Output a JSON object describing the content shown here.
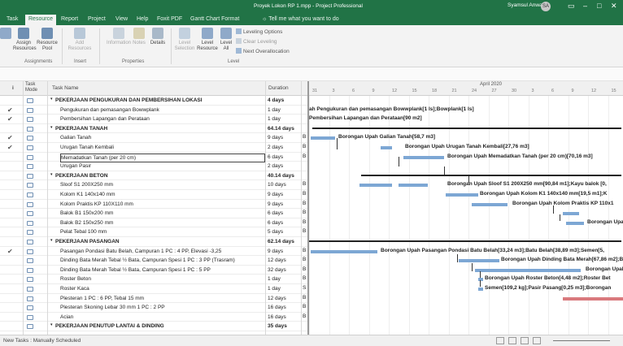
{
  "window": {
    "title": "Proyek Lokon RP 1.mpp  -  Project Professional",
    "user": "Syamsul Anwar",
    "user_initials": "SA"
  },
  "ribbon_tabs": [
    "Task",
    "Resource",
    "Report",
    "Project",
    "View",
    "Help",
    "Foxit PDF",
    "Gantt Chart Format"
  ],
  "tell_me": "Tell me what you want to do",
  "ribbon": {
    "buttons": [
      {
        "label": "Team\nPlanner",
        "icon": "team-planner-icon"
      },
      {
        "label": "Assign\nResources",
        "icon": "assign-resources-icon"
      },
      {
        "label": "Resource\nPool",
        "icon": "resource-pool-icon"
      },
      {
        "label": "Add\nResources",
        "icon": "add-resources-icon"
      },
      {
        "label": "Information",
        "icon": "information-icon"
      },
      {
        "label": "Notes",
        "icon": "notes-icon"
      },
      {
        "label": "Details",
        "icon": "details-icon"
      },
      {
        "label": "Level\nSelection",
        "icon": "level-selection-icon"
      },
      {
        "label": "Level\nResource",
        "icon": "level-resource-icon"
      },
      {
        "label": "Level\nAll",
        "icon": "level-all-icon"
      }
    ],
    "groups": [
      "Assignments",
      "Insert",
      "Properties",
      "Level"
    ],
    "level_options": [
      "Leveling Options",
      "Clear Leveling",
      "Next Overallocation"
    ]
  },
  "columns": {
    "info": "i",
    "mode": "Task Mode",
    "name": "Task Name",
    "duration": "Duration"
  },
  "gantt": {
    "month": "April 2020",
    "days": [
      "31",
      "3",
      "6",
      "9",
      "12",
      "15",
      "18",
      "21",
      "24",
      "27",
      "30",
      "3",
      "6",
      "9",
      "12",
      "15"
    ]
  },
  "tasks": [
    {
      "num": "",
      "check": "",
      "name": "PEKERJAAN PENGUKURAN DAN PEMBERSIHAN LOKASI",
      "duration": "4 days",
      "summary": true,
      "indent": 0,
      "start": ""
    },
    {
      "num": "",
      "check": "✔",
      "name": "Pengukuran dan pemasangan Bowwplank",
      "duration": "1 day",
      "summary": false,
      "indent": 1,
      "start": ""
    },
    {
      "num": "",
      "check": "✔",
      "name": "Pembersihan Lapangan dan Perataan",
      "duration": "1 day",
      "summary": false,
      "indent": 1,
      "start": ""
    },
    {
      "num": "",
      "check": "",
      "name": "PEKERJAAN TANAH",
      "duration": "64.14 days",
      "summary": true,
      "indent": 0,
      "start": ""
    },
    {
      "num": "",
      "check": "✔",
      "name": "Galian Tanah",
      "duration": "9 days",
      "summary": false,
      "indent": 1,
      "start": "B"
    },
    {
      "num": "",
      "check": "✔",
      "name": "Urugan Tanah Kembali",
      "duration": "2 days",
      "summary": false,
      "indent": 1,
      "start": "B"
    },
    {
      "num": "",
      "check": "",
      "name": "Memadatkan Tanah (per 20 cm)",
      "duration": "6 days",
      "summary": false,
      "indent": 1,
      "start": "B",
      "selected": true
    },
    {
      "num": "",
      "check": "",
      "name": "Urugan Pasir",
      "duration": "2 days",
      "summary": false,
      "indent": 1,
      "start": ""
    },
    {
      "num": "",
      "check": "",
      "name": "PEKERJAAN BETON",
      "duration": "40.14 days",
      "summary": true,
      "indent": 0,
      "start": ""
    },
    {
      "num": "",
      "check": "",
      "name": "Sloof S1 200X250 mm",
      "duration": "10 days",
      "summary": false,
      "indent": 1,
      "start": "B"
    },
    {
      "num": "",
      "check": "",
      "name": "Kolom K1 140x140 mm",
      "duration": "9 days",
      "summary": false,
      "indent": 1,
      "start": "B"
    },
    {
      "num": "",
      "check": "",
      "name": "Kolom Praktis KP 110X110 mm",
      "duration": "9 days",
      "summary": false,
      "indent": 1,
      "start": "B"
    },
    {
      "num": "",
      "check": "",
      "name": "Balok B1 150x200 mm",
      "duration": "6 days",
      "summary": false,
      "indent": 1,
      "start": "B"
    },
    {
      "num": "",
      "check": "",
      "name": "Balok B2 150x250 mm",
      "duration": "6 days",
      "summary": false,
      "indent": 1,
      "start": "B"
    },
    {
      "num": "",
      "check": "",
      "name": "Pelat Tebal 100 mm",
      "duration": "5 days",
      "summary": false,
      "indent": 1,
      "start": "B"
    },
    {
      "num": "",
      "check": "",
      "name": "PEKERJAAN PASANGAN",
      "duration": "62.14 days",
      "summary": true,
      "indent": 0,
      "start": ""
    },
    {
      "num": "",
      "check": "✔",
      "name": "Pasangan Pondasi Batu Belah, Campuran 1 PC : 4 PP, Elevasi -3,25",
      "duration": "9 days",
      "summary": false,
      "indent": 1,
      "start": "B"
    },
    {
      "num": "",
      "check": "",
      "name": "Dinding Bata Merah Tebal ½ Bata, Campuran Spesi 1 PC : 3 PP (Trasram)",
      "duration": "12 days",
      "summary": false,
      "indent": 1,
      "start": "B"
    },
    {
      "num": "",
      "check": "",
      "name": "Dinding Bata Merah Tebal ½ Bata, Campuran Spesi 1 PC : 5 PP",
      "duration": "32 days",
      "summary": false,
      "indent": 1,
      "start": "B"
    },
    {
      "num": "",
      "check": "",
      "name": "Roster Beton",
      "duration": "1 day",
      "summary": false,
      "indent": 1,
      "start": "B"
    },
    {
      "num": "",
      "check": "",
      "name": "Roster Kaca",
      "duration": "1 day",
      "summary": false,
      "indent": 1,
      "start": "S"
    },
    {
      "num": "",
      "check": "",
      "name": "Plesteran 1 PC : 6 PP, Tebal 15 mm",
      "duration": "12 days",
      "summary": false,
      "indent": 1,
      "start": "B"
    },
    {
      "num": "",
      "check": "",
      "name": "Plesteran Skoning Lebar 30 mm 1 PC : 2 PP",
      "duration": "16 days",
      "summary": false,
      "indent": 1,
      "start": "B"
    },
    {
      "num": "",
      "check": "",
      "name": "Acian",
      "duration": "16 days",
      "summary": false,
      "indent": 1,
      "start": "B"
    },
    {
      "num": "",
      "check": "",
      "name": "PEKERJAAN PENUTUP LANTAI & DINDING",
      "duration": "35 days",
      "summary": true,
      "indent": 0,
      "start": ""
    }
  ],
  "gantt_labels": [
    "ah Pengukuran dan pemasangan Bowwplank[1 ls];Bowplank[1 ls]",
    "Pembersihan Lapangan dan Perataan[90 m2]",
    "Borongan Upah Galian Tanah[58,7 m3]",
    "Borongan Upah Urugan Tanah Kembali[27,76 m3]",
    "Borongan Upah Memadatkan Tanah (per 20 cm)[70,16 m3]",
    "Borongan Upah Sloof S1 200X250 mm[90,84 m1];Kayu balok [0,",
    "Borongan Upah Kolom K1 140x140 mm[19,5 m1];K",
    "Borongan Upah Kolom Praktis KP 110x1",
    "Borongan Upa",
    "Borongan Upah Pasangan Pondasi Batu Belah[33,24 m3];Batu Belah[38,89 m3];Semen[5,",
    "Borongan Upah Dinding Bata Merah[67,86 m2];Bata",
    "Borongan Upah Dindi",
    "Borongan Upah Roster Beton[4,48 m2];Roster Bet",
    "Semen[109,2 kg];Pasir Pasang[0,25 m3];Borongan"
  ],
  "status": {
    "new_tasks": "New Tasks : Manually Scheduled"
  },
  "colors": {
    "brand": "#217346",
    "task_bar": "#7da7d4",
    "critical_bar": "#d9797d"
  }
}
